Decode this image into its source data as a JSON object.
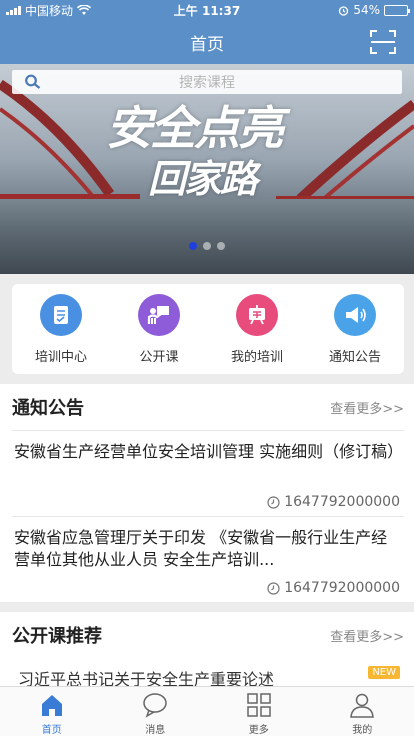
{
  "status_bar": {
    "carrier": "中国移动",
    "time": "上午 11:37",
    "battery": "54%",
    "battery_level": 0.54
  },
  "nav": {
    "title": "首页"
  },
  "search": {
    "placeholder": "搜索课程"
  },
  "banner": {
    "slogan_line1": "安全点亮",
    "slogan_line2": "回家路",
    "slide_count": 3,
    "active_slide": 0
  },
  "quick_menu": [
    {
      "label": "培训中心",
      "icon": "training-center-icon",
      "color": "#4a90e2"
    },
    {
      "label": "公开课",
      "icon": "open-class-icon",
      "color": "#8e5cd9"
    },
    {
      "label": "我的培训",
      "icon": "my-training-icon",
      "color": "#e84c7c"
    },
    {
      "label": "通知公告",
      "icon": "announcement-icon",
      "color": "#4aa3e8"
    }
  ],
  "notices": {
    "title": "通知公告",
    "more": "查看更多>>",
    "items": [
      {
        "text": "安徽省生产经营单位安全培训管理 实施细则（修订稿）",
        "time": "1647792000000"
      },
      {
        "text": "安徽省应急管理厅关于印发 《安徽省一般行业生产经营单位其他从业人员 安全生产培训...",
        "time": "1647792000000"
      }
    ]
  },
  "courses": {
    "title": "公开课推荐",
    "more": "查看更多>>",
    "items": [
      {
        "text": "习近平总书记关于安全生产重要论述",
        "badge": "NEW"
      }
    ]
  },
  "tabs": [
    {
      "label": "首页",
      "icon": "home-icon",
      "active": true
    },
    {
      "label": "消息",
      "icon": "message-icon",
      "active": false
    },
    {
      "label": "更多",
      "icon": "grid-icon",
      "active": false
    },
    {
      "label": "我的",
      "icon": "profile-icon",
      "active": false
    }
  ],
  "colors": {
    "brand": "#5b8fc8",
    "tab_active": "#3a7bd5",
    "badge": "#f7b733"
  }
}
